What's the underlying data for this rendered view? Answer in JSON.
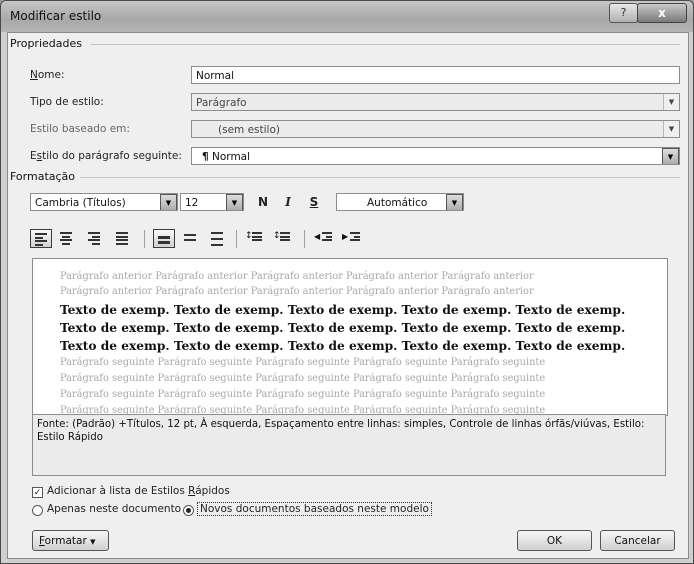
{
  "window": {
    "title": "Modificar estilo",
    "help_label": "?",
    "close_label": "x"
  },
  "properties": {
    "group_label": "Propriedades",
    "name_label": "Nome:",
    "name_value": "Normal",
    "style_type_label": "Tipo de estilo:",
    "style_type_value": "Parágrafo",
    "based_on_label": "Estilo baseado em:",
    "based_on_value": "(sem estilo)",
    "next_style_label": "Estilo do parágrafo seguinte:",
    "next_style_glyph": "¶",
    "next_style_value": "Normal"
  },
  "formatting": {
    "group_label": "Formatação",
    "font_value": "Cambria (Títulos)",
    "size_value": "12",
    "bold_label": "N",
    "italic_label": "I",
    "underline_label": "S",
    "color_value": "Automático"
  },
  "preview": {
    "previous_lines": [
      "Parágrafo anterior Parágrafo anterior Parágrafo anterior Parágrafo anterior Parágrafo anterior",
      "Parágrafo anterior Parágrafo anterior Parágrafo anterior Parágrafo anterior Parágrafo anterior"
    ],
    "sample_lines": [
      "Texto de exemp. Texto de exemp. Texto de exemp. Texto de exemp. Texto de exemp.",
      "Texto de exemp. Texto de exemp. Texto de exemp. Texto de exemp. Texto de exemp.",
      "Texto de exemp. Texto de exemp. Texto de exemp. Texto de exemp. Texto de exemp."
    ],
    "next_lines": [
      "Parágrafo seguinte Parágrafo seguinte Parágrafo seguinte Parágrafo seguinte Parágrafo seguinte",
      "Parágrafo seguinte Parágrafo seguinte Parágrafo seguinte Parágrafo seguinte Parágrafo seguinte",
      "Parágrafo seguinte Parágrafo seguinte Parágrafo seguinte Parágrafo seguinte Parágrafo seguinte",
      "Parágrafo seguinte Parágrafo seguinte Parágrafo seguinte Parágrafo seguinte Parágrafo seguinte"
    ]
  },
  "description": "Fonte: (Padrão) +Títulos, 12 pt, À esquerda, Espaçamento entre linhas:  simples, Controle de linhas órfãs/viúvas, Estilo: Estilo Rápido",
  "options": {
    "add_quick_styles_label": "Adicionar à lista de Estilos Rápidos",
    "add_quick_styles_checked": true,
    "only_document_label": "Apenas neste documento",
    "new_documents_label": "Novos documentos baseados neste modelo"
  },
  "buttons": {
    "format_label": "Formatar",
    "ok_label": "OK",
    "cancel_label": "Cancelar"
  }
}
